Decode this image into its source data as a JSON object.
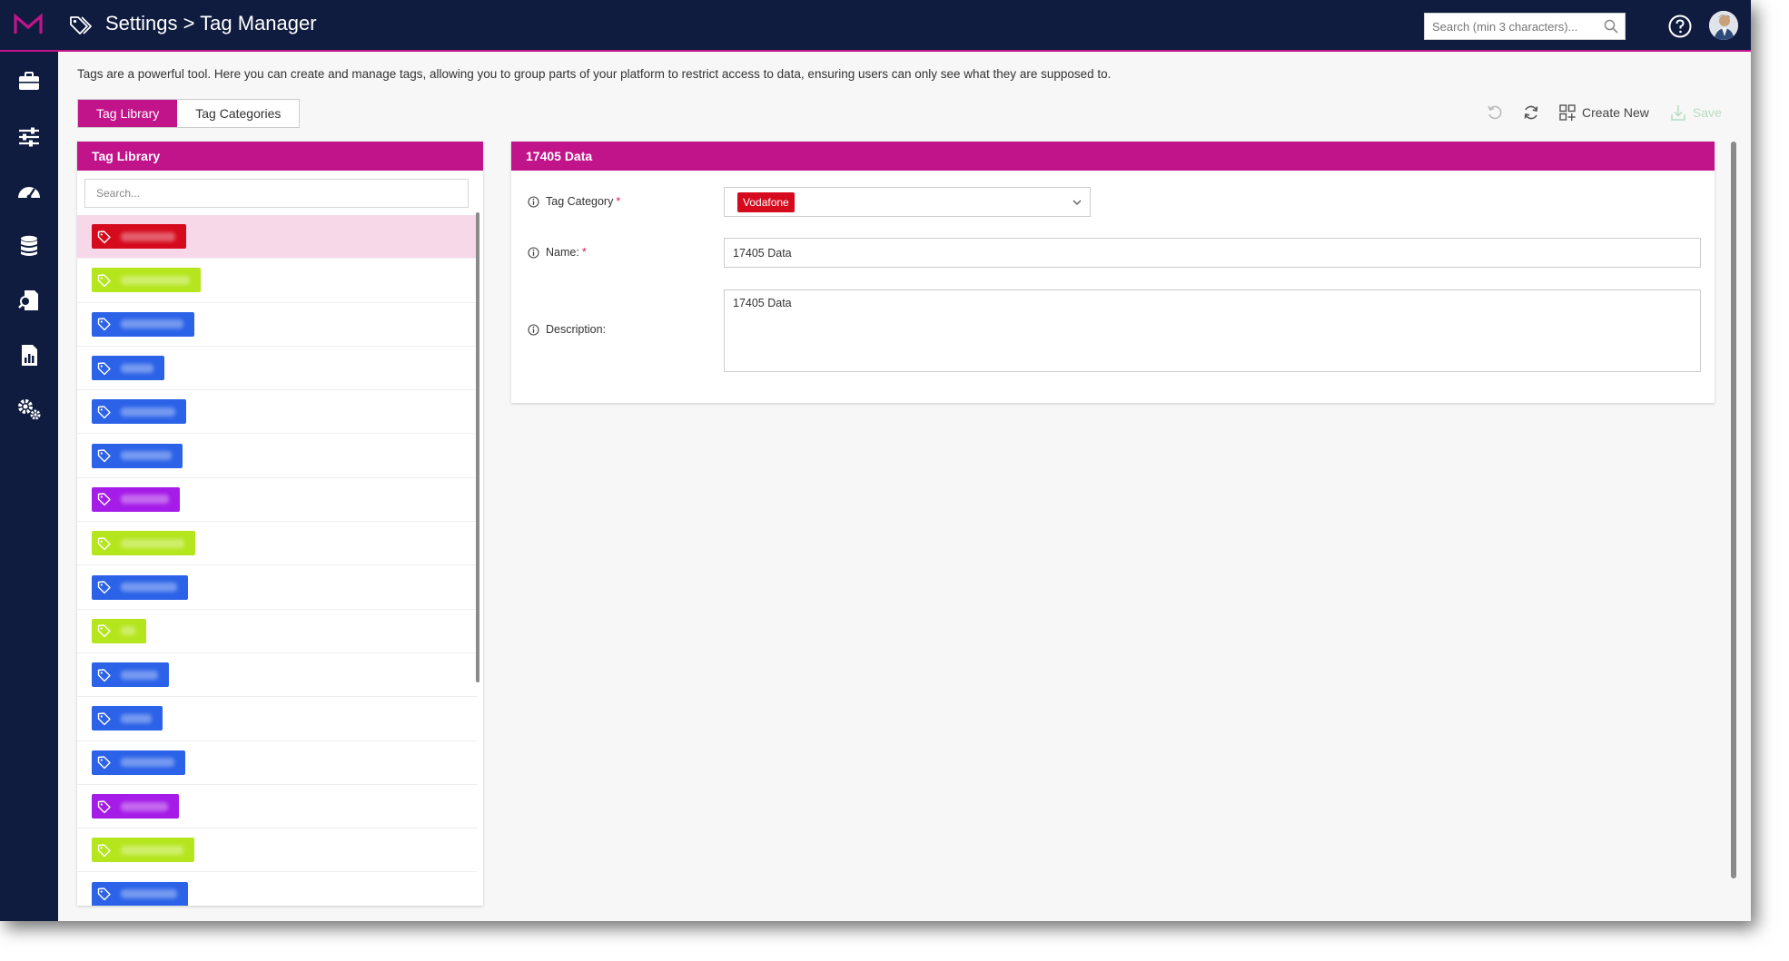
{
  "header": {
    "title": "Settings > Tag Manager",
    "search_placeholder": "Search (min 3 characters)...",
    "brand_color": "#c2148a",
    "bar_color": "#0f1c3f"
  },
  "sidebar": {
    "items": [
      {
        "icon": "briefcase-icon"
      },
      {
        "icon": "sliders-icon"
      },
      {
        "icon": "dashboard-gauge-icon"
      },
      {
        "icon": "database-icon"
      },
      {
        "icon": "document-search-icon"
      },
      {
        "icon": "report-chart-icon"
      },
      {
        "icon": "gears-icon"
      }
    ]
  },
  "intro_text": "Tags are a powerful tool. Here you can create and manage tags, allowing you to group parts of your platform to restrict access to data, ensuring users can only see what they are supposed to.",
  "tabs": [
    {
      "label": "Tag Library",
      "active": true
    },
    {
      "label": "Tag Categories",
      "active": false
    }
  ],
  "toolbar": {
    "create_new_label": "Create New",
    "save_label": "Save"
  },
  "tag_library": {
    "title": "Tag Library",
    "search_placeholder": "Search...",
    "tags": [
      {
        "color": "#d50a1d",
        "selected": true
      },
      {
        "color": "#b5e61d",
        "selected": false
      },
      {
        "color": "#2b62e8",
        "selected": false
      },
      {
        "color": "#2b62e8",
        "selected": false
      },
      {
        "color": "#2b62e8",
        "selected": false
      },
      {
        "color": "#2b62e8",
        "selected": false
      },
      {
        "color": "#a51be8",
        "selected": false
      },
      {
        "color": "#b5e61d",
        "selected": false
      },
      {
        "color": "#2b62e8",
        "selected": false
      },
      {
        "color": "#b5e61d",
        "selected": false
      },
      {
        "color": "#2b62e8",
        "selected": false
      },
      {
        "color": "#2b62e8",
        "selected": false
      },
      {
        "color": "#2b62e8",
        "selected": false
      },
      {
        "color": "#a51be8",
        "selected": false
      },
      {
        "color": "#b5e61d",
        "selected": false
      },
      {
        "color": "#2b62e8",
        "selected": false
      }
    ]
  },
  "detail": {
    "title": "17405 Data",
    "category_label": "Tag Category",
    "category_value": "Vodafone",
    "category_color": "#d50a1d",
    "name_label": "Name:",
    "name_value": "17405 Data",
    "description_label": "Description:",
    "description_value": "17405 Data",
    "required_mark": "*"
  }
}
